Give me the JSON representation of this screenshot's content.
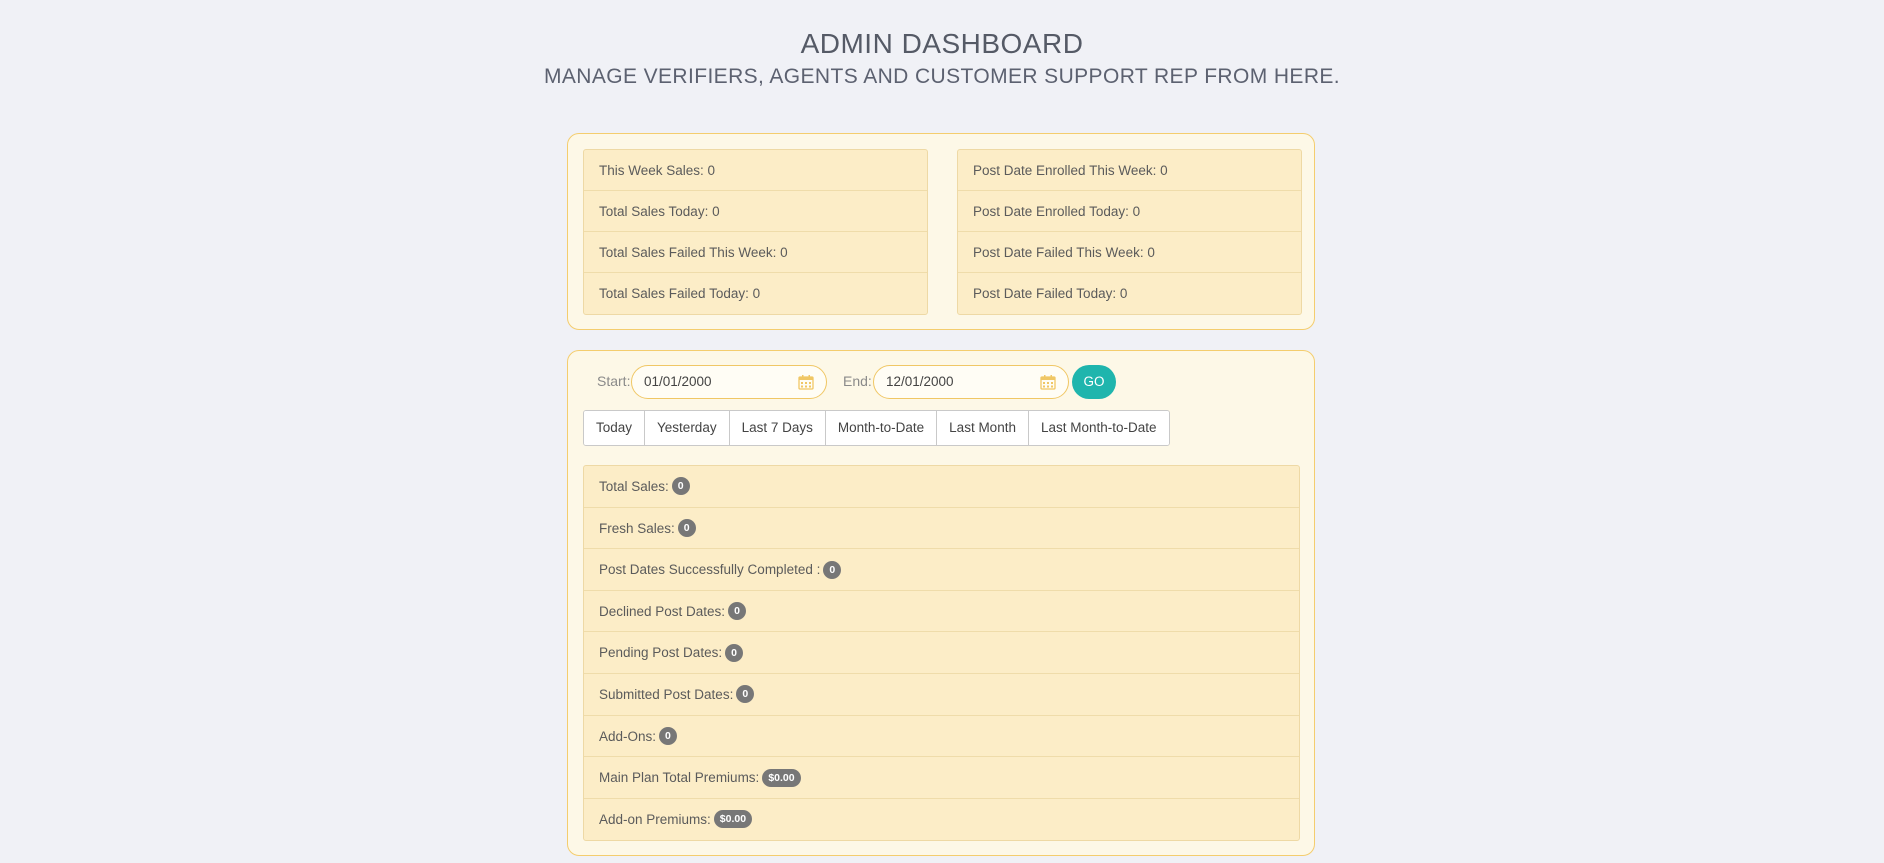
{
  "header": {
    "title": "ADMIN DASHBOARD",
    "subtitle": "MANAGE VERIFIERS, AGENTS AND CUSTOMER SUPPORT REP FROM HERE."
  },
  "summary": {
    "left": [
      "This Week Sales: 0",
      "Total Sales Today: 0",
      "Total Sales Failed This Week: 0",
      "Total Sales Failed Today: 0"
    ],
    "right": [
      "Post Date Enrolled This Week: 0",
      "Post Date Enrolled Today: 0",
      "Post Date Failed This Week: 0",
      "Post Date Failed Today: 0"
    ]
  },
  "filter": {
    "start_label": "Start:",
    "start_value": "01/01/2000",
    "end_label": "End:",
    "end_value": "12/01/2000",
    "go_label": "GO"
  },
  "ranges": [
    "Today",
    "Yesterday",
    "Last 7 Days",
    "Month-to-Date",
    "Last Month",
    "Last Month-to-Date"
  ],
  "metrics": [
    {
      "label": "Total Sales:",
      "value": "0"
    },
    {
      "label": "Fresh Sales:",
      "value": "0"
    },
    {
      "label": "Post Dates Successfully Completed :",
      "value": "0"
    },
    {
      "label": "Declined Post Dates:",
      "value": "0"
    },
    {
      "label": "Pending Post Dates:",
      "value": "0"
    },
    {
      "label": "Submitted Post Dates:",
      "value": "0"
    },
    {
      "label": "Add-Ons:",
      "value": "0"
    },
    {
      "label": "Main Plan Total Premiums:",
      "value": "$0.00"
    },
    {
      "label": "Add-on Premiums:",
      "value": "$0.00"
    }
  ],
  "colors": {
    "accent": "#1fb5ad",
    "panel_border": "#f4cd6e",
    "row_bg": "#fcedc7",
    "badge": "#777777"
  },
  "icons": {
    "date_picker": "calendar-icon"
  }
}
